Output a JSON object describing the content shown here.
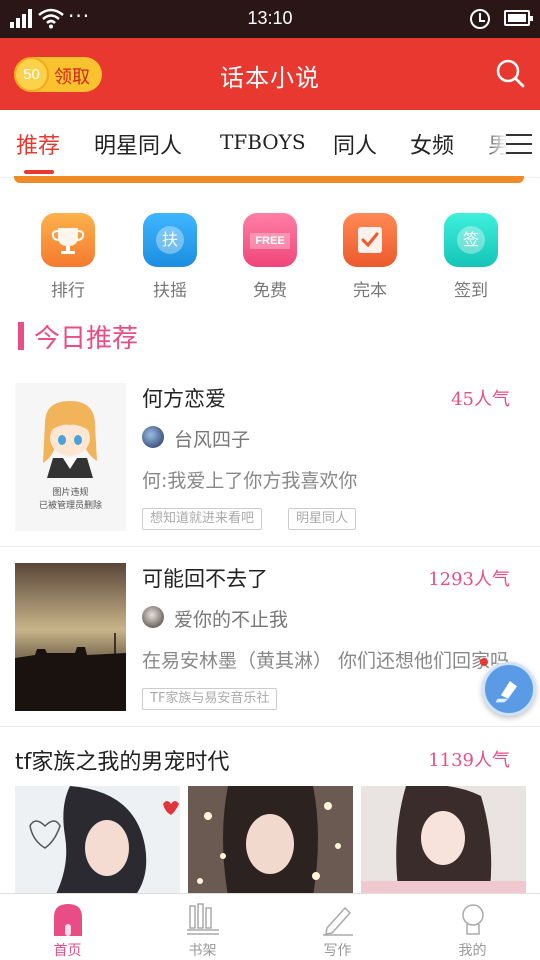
{
  "status_bar": {
    "time": "13:10",
    "dots": "···"
  },
  "header": {
    "title": "话本小说",
    "claim": {
      "coins": "50",
      "label": "领取"
    }
  },
  "tabs": [
    {
      "label": "推荐"
    },
    {
      "label": "明星同人"
    },
    {
      "label": "TFBOYS"
    },
    {
      "label": "同人"
    },
    {
      "label": "女频"
    },
    {
      "label": "男"
    }
  ],
  "quick_links": [
    {
      "label": "排行",
      "icon": "trophy-icon",
      "color": "#f7923a"
    },
    {
      "label": "扶摇",
      "icon": "support-icon",
      "color": "#2ea3f2",
      "glyph": "扶"
    },
    {
      "label": "免费",
      "icon": "free-icon",
      "color": "#f45c8a",
      "glyph": "FREE"
    },
    {
      "label": "完本",
      "icon": "complete-icon",
      "color": "#f2673a"
    },
    {
      "label": "签到",
      "icon": "checkin-icon",
      "color": "#1fd3c6",
      "glyph": "签"
    }
  ],
  "section": {
    "title": "今日推荐"
  },
  "books": [
    {
      "title": "何方恋爱",
      "popularity": "45人气",
      "author": "台风四子",
      "description": "何:我爱上了你方我喜欢你",
      "tags": [
        "想知道就进来看吧",
        "明星同人"
      ],
      "cover_notice": [
        "图片违规",
        "已被管理员删除"
      ]
    },
    {
      "title": "可能回不去了",
      "popularity": "1293人气",
      "author": "爱你的不止我",
      "description": "在易安林墨（黄其淋） 你们还想他们回家吗",
      "tags": [
        "TF家族与易安音乐社"
      ]
    }
  ],
  "feature": {
    "title": "tf家族之我的男宠时代",
    "popularity": "1139人气"
  },
  "bottom_nav": [
    {
      "label": "首页",
      "icon": "home-icon",
      "active": true
    },
    {
      "label": "书架",
      "icon": "bookshelf-icon"
    },
    {
      "label": "写作",
      "icon": "write-icon"
    },
    {
      "label": "我的",
      "icon": "profile-icon"
    }
  ],
  "colors": {
    "brand_red": "#e8382f",
    "accent_pink": "#e94d86",
    "gold": "#f9c22e"
  }
}
